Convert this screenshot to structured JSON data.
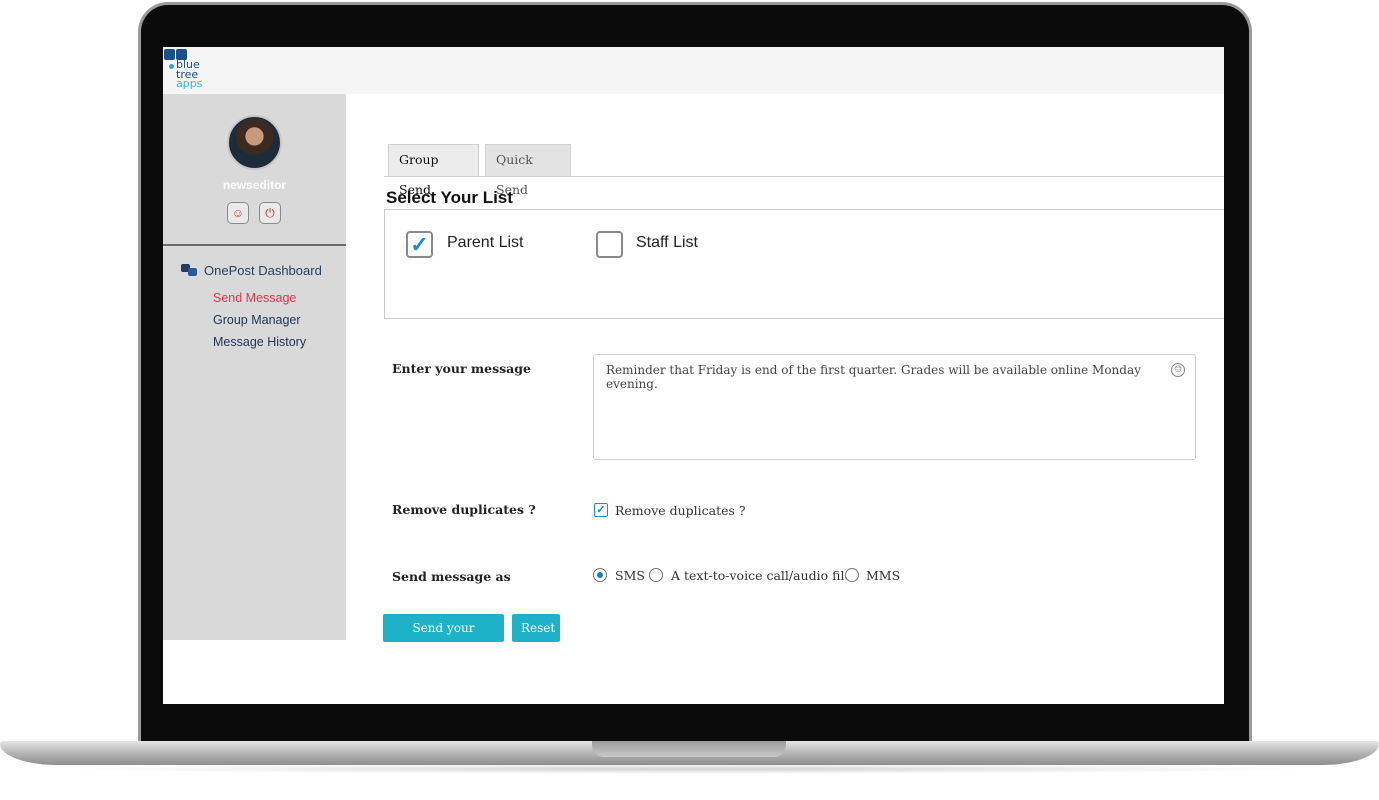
{
  "logo": {
    "line1": "blue",
    "line2": "tree",
    "line3": "apps"
  },
  "sidebar": {
    "username": "newseditor",
    "profile_icon": "user-icon",
    "power_icon": "power-icon",
    "nav_heading": "OnePost Dashboard",
    "items": [
      {
        "label": "Send Message",
        "active": true
      },
      {
        "label": "Group Manager",
        "active": false
      },
      {
        "label": "Message History",
        "active": false
      }
    ]
  },
  "tabs": [
    {
      "label": "Group Send",
      "active": true
    },
    {
      "label": "Quick Send",
      "active": false
    }
  ],
  "lists": {
    "title": "Select Your List",
    "options": [
      {
        "label": "Parent List",
        "checked": true
      },
      {
        "label": "Staff List",
        "checked": false
      }
    ]
  },
  "form": {
    "message_label": "Enter your message",
    "message_value": "Reminder that Friday is end of the first quarter. Grades will be available online Monday evening.",
    "duplicates_label": "Remove duplicates ?",
    "duplicates_checkbox_label": "Remove duplicates ?",
    "duplicates_checked": true,
    "send_as_label": "Send message as",
    "send_as_options": [
      {
        "label": "SMS",
        "selected": true
      },
      {
        "label": "A text-to-voice call/audio file",
        "selected": false
      },
      {
        "label": "MMS",
        "selected": false
      }
    ]
  },
  "buttons": {
    "send": "Send your message",
    "reset": "Reset"
  },
  "colors": {
    "accent": "#1eb2c9",
    "active_nav": "#e0344a",
    "sidebar_bg": "#d9d9d9"
  }
}
